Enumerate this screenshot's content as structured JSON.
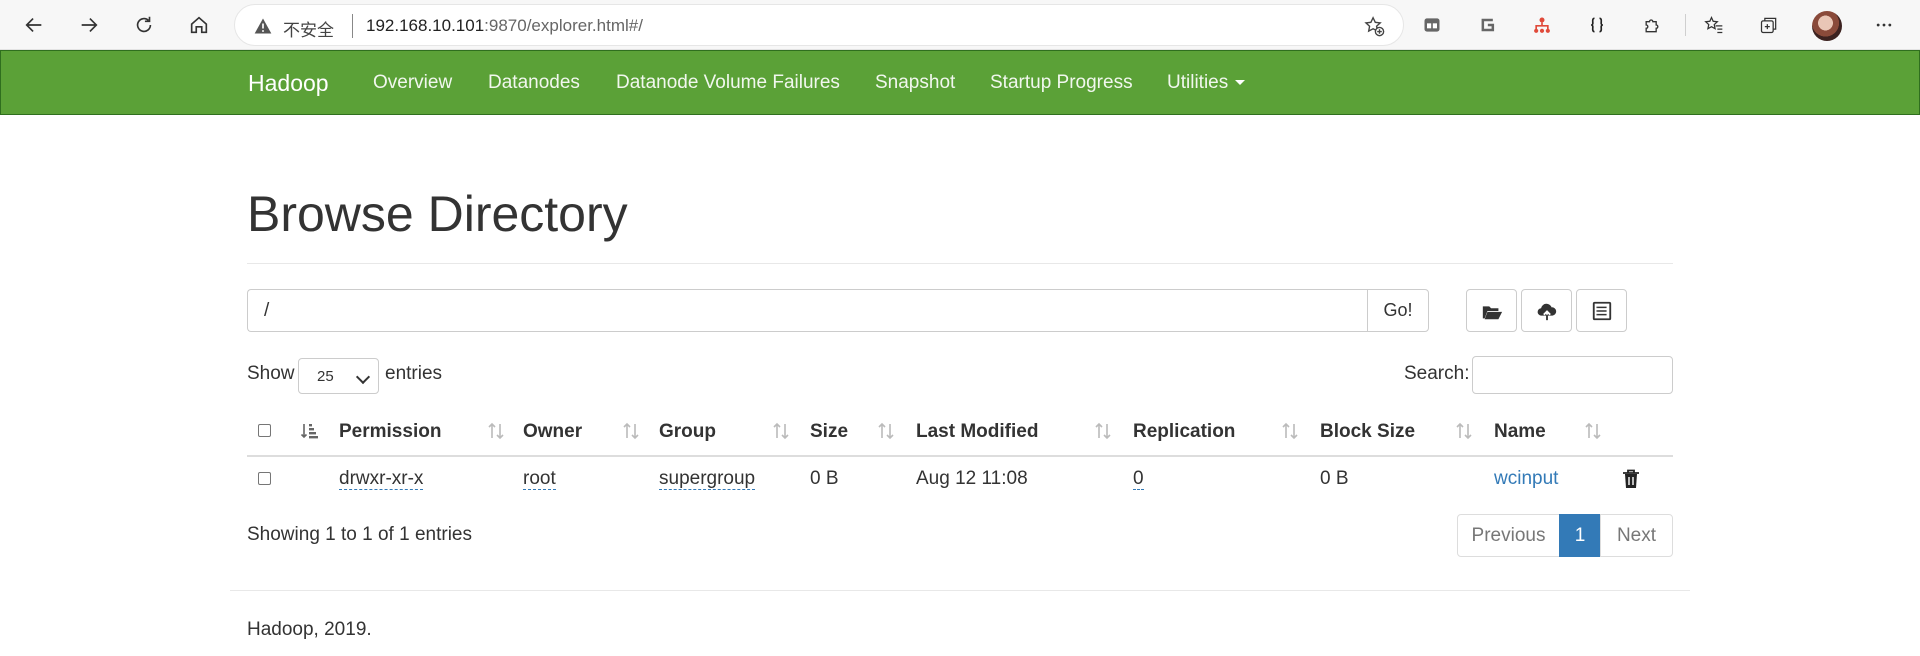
{
  "browser": {
    "security_label": "不安全",
    "url_host": "192.168.10.101",
    "url_rest": ":9870/explorer.html#/"
  },
  "navbar": {
    "brand": "Hadoop",
    "links": [
      "Overview",
      "Datanodes",
      "Datanode Volume Failures",
      "Snapshot",
      "Startup Progress",
      "Utilities"
    ]
  },
  "page": {
    "title": "Browse Directory",
    "path_value": "/",
    "go_label": "Go!",
    "show_label": "Show",
    "entries_per_page": "25",
    "entries_label": "entries",
    "search_label": "Search:"
  },
  "table": {
    "headers": [
      "Permission",
      "Owner",
      "Group",
      "Size",
      "Last Modified",
      "Replication",
      "Block Size",
      "Name"
    ],
    "rows": [
      {
        "permission": "drwxr-xr-x",
        "owner": "root",
        "group": "supergroup",
        "size": "0 B",
        "last_modified": "Aug 12 11:08",
        "replication": "0",
        "block_size": "0 B",
        "name": "wcinput"
      }
    ]
  },
  "pagination": {
    "info": "Showing 1 to 1 of 1 entries",
    "previous": "Previous",
    "current": "1",
    "next": "Next"
  },
  "footer": {
    "text": "Hadoop, 2019."
  },
  "colors": {
    "navbar": "#5ba137",
    "link": "#337ab7"
  }
}
